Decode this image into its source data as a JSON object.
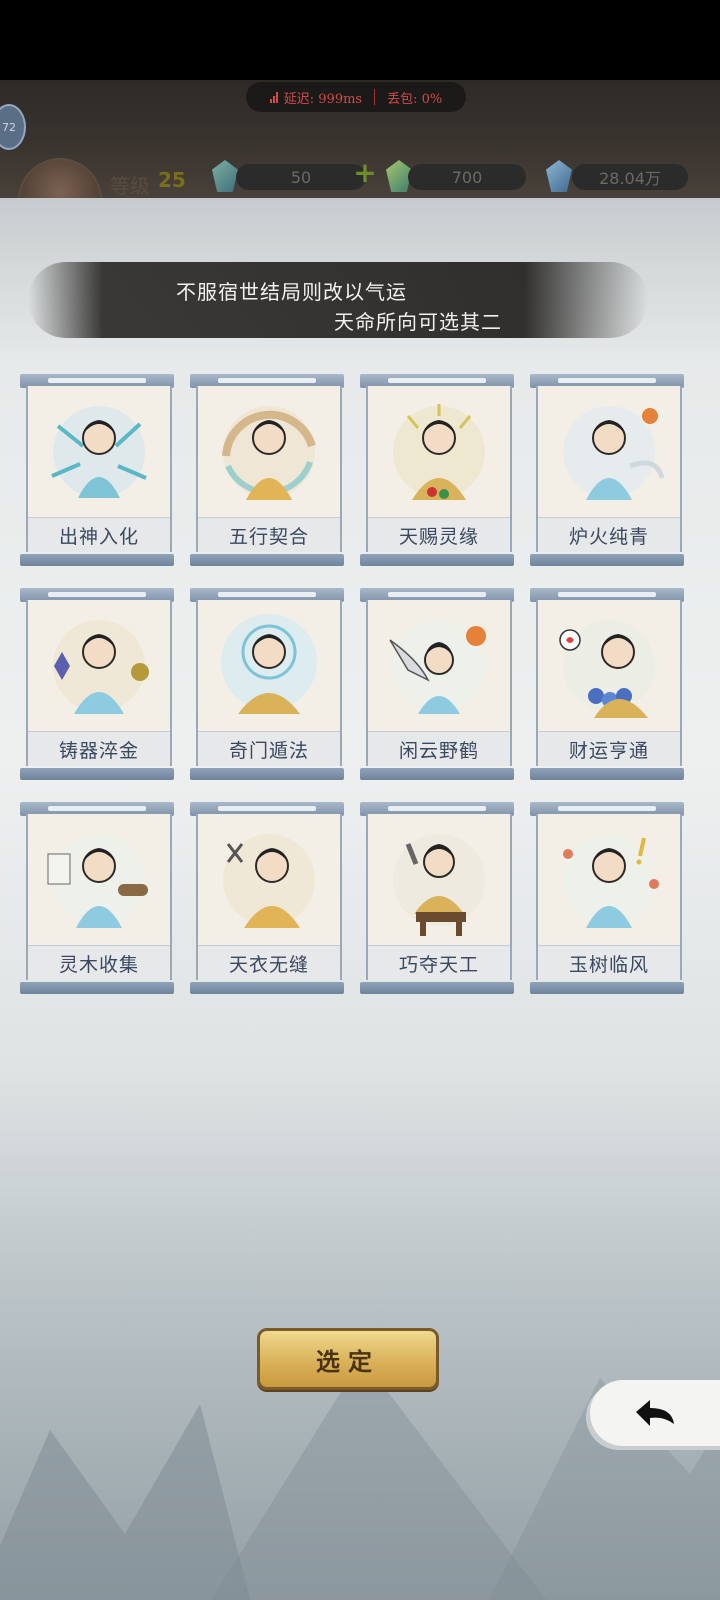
{
  "status_bar": {
    "latency_label": "延迟: 999ms",
    "packet_loss_label": "丢包: 0%",
    "net_color": "#d24a4a"
  },
  "player": {
    "mini_badge": "72",
    "level_label": "等级",
    "level_value": "25"
  },
  "resources": [
    {
      "icon": "jade-gem-icon",
      "value": "50"
    },
    {
      "icon": "green-gem-icon",
      "value": "700"
    },
    {
      "icon": "blue-crystal-icon",
      "value": "28.04万"
    }
  ],
  "banner": {
    "line1": "不服宿世结局则改以气运",
    "line2": "天命所向可选其二"
  },
  "talents": [
    {
      "name": "出神入化",
      "icon": "sword-cultivator-icon"
    },
    {
      "name": "五行契合",
      "icon": "five-elements-icon"
    },
    {
      "name": "天赐灵缘",
      "icon": "fortune-cultivator-icon"
    },
    {
      "name": "炉火纯青",
      "icon": "alchemy-fire-icon"
    },
    {
      "name": "铸器淬金",
      "icon": "forging-icon"
    },
    {
      "name": "奇门遁法",
      "icon": "formation-icon"
    },
    {
      "name": "闲云野鹤",
      "icon": "crane-icon"
    },
    {
      "name": "财运亨通",
      "icon": "wealth-icon"
    },
    {
      "name": "灵木收集",
      "icon": "wood-gathering-icon"
    },
    {
      "name": "天衣无缝",
      "icon": "tailoring-icon"
    },
    {
      "name": "巧夺天工",
      "icon": "crafting-icon"
    },
    {
      "name": "玉树临风",
      "icon": "graceful-cultivator-icon"
    }
  ],
  "actions": {
    "select_label": "选定",
    "back_icon": "back-arrow-icon"
  },
  "colors": {
    "label_text": "#3a4960",
    "button_gold": "#d9b25a",
    "scroll_rod": "#7f93ab"
  }
}
